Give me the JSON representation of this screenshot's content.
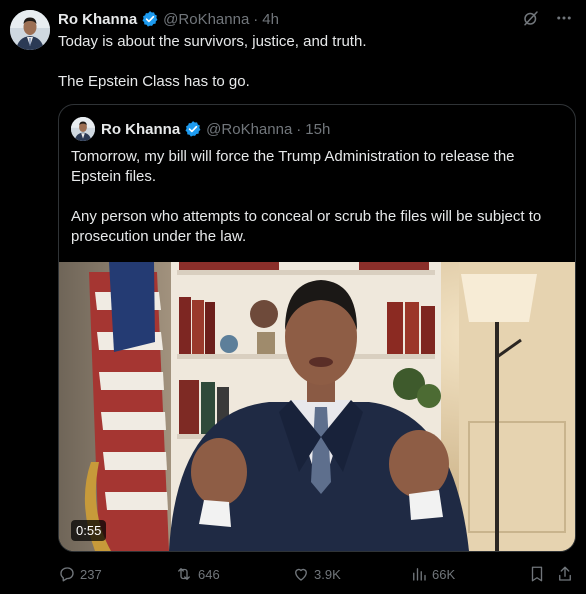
{
  "post": {
    "author_name": "Ro Khanna",
    "handle": "@RoKhanna",
    "separator": "·",
    "time": "4h",
    "text_line1": "Today is about the survivors, justice, and truth.",
    "text_line2": "The Epstein Class has to go."
  },
  "quote": {
    "author_name": "Ro Khanna",
    "handle": "@RoKhanna",
    "separator": "·",
    "time": "15h",
    "text_para1": "Tomorrow, my bill will force the Trump Administration to release the Epstein files.",
    "text_para2": "Any person who attempts to conceal or scrub the files will be subject to prosecution under the law.",
    "video_duration": "0:55"
  },
  "actions": {
    "replies": "237",
    "reposts": "646",
    "likes": "3.9K",
    "views": "66K"
  },
  "colors": {
    "background": "#000000",
    "text": "#e7e9ea",
    "muted": "#71767b",
    "verified": "#1d9bf0",
    "border": "#2f3336"
  },
  "icons": {
    "verified": "verified-badge-icon",
    "grok": "grok-icon",
    "more": "more-icon",
    "reply": "reply-icon",
    "repost": "repost-icon",
    "like": "like-icon",
    "views": "views-icon",
    "bookmark": "bookmark-icon",
    "share": "share-icon"
  }
}
